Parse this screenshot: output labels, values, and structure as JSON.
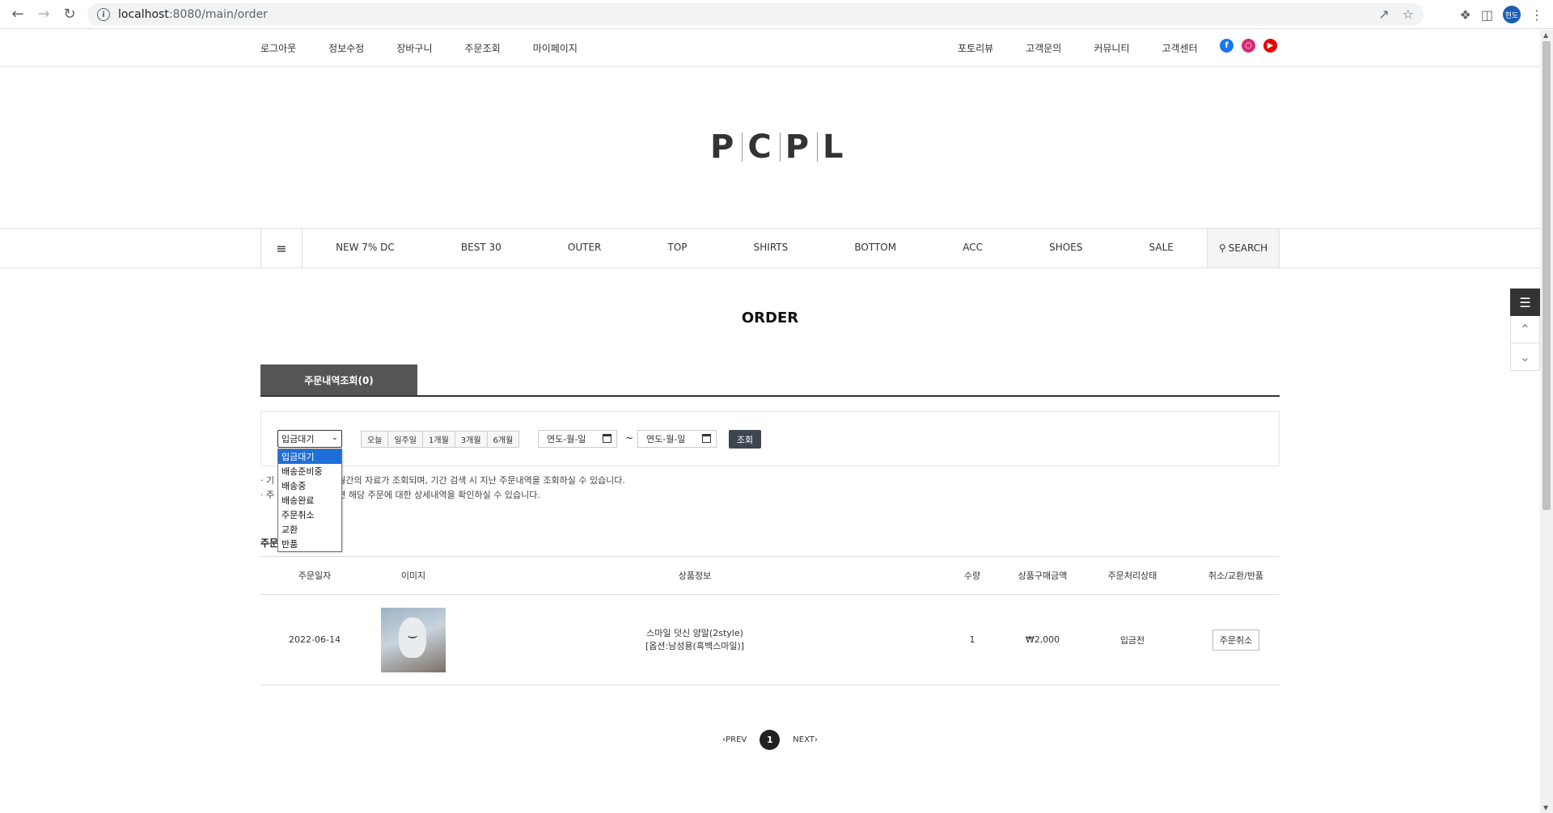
{
  "browser": {
    "url_host": "localhost",
    "url_path": ":8080/main/order",
    "profile": "현도"
  },
  "topbar": {
    "left": [
      "로그아웃",
      "정보수정",
      "장바구니",
      "주문조회",
      "마이페이지"
    ],
    "right": [
      "포토리뷰",
      "고객문의",
      "커뮤니티",
      "고객센터"
    ]
  },
  "logo": {
    "letters": [
      "P",
      "C",
      "P",
      "L"
    ]
  },
  "catnav": {
    "menu_icon": "≡",
    "items": [
      "NEW 7% DC",
      "BEST 30",
      "OUTER",
      "TOP",
      "SHIRTS",
      "BOTTOM",
      "ACC",
      "SHOES",
      "SALE"
    ],
    "search_label": "SEARCH"
  },
  "page": {
    "title": "ORDER"
  },
  "tab": {
    "label": "주문내역조회(0)"
  },
  "filter": {
    "status_selected": "입금대기",
    "status_options": [
      "입금대기",
      "배송준비중",
      "배송중",
      "배송완료",
      "주문취소",
      "교환",
      "반품"
    ],
    "periods": [
      "오늘",
      "일주일",
      "1개월",
      "3개월",
      "6개월"
    ],
    "date_from": "연도-월-일",
    "date_to": "연도-월-일",
    "tilde": "~",
    "search_button": "조회"
  },
  "notes": [
    "· 기",
    "개월간의 자료가 조회되며, 기간 검색 시 지난 주문내역을 조회하실 수 있습니다.",
    "· 주",
    "시면 해당 주문에 대한 상세내역을 확인하실 수 있습니다."
  ],
  "list_caption": "주문",
  "table": {
    "headers": [
      "주문일자",
      "이미지",
      "상품정보",
      "수량",
      "상품구매금액",
      "주문처리상태",
      "취소/교환/반품"
    ],
    "rows": [
      {
        "date": "2022-06-14",
        "product_name": "스마일 덧신 양말(2style)",
        "product_option": "[옵션:남성용(흑백스마일)]",
        "qty": "1",
        "price": "₩2,000",
        "status": "입금전",
        "action": "주문취소"
      }
    ]
  },
  "pager": {
    "prev": "PREV",
    "current": "1",
    "next": "NEXT"
  }
}
